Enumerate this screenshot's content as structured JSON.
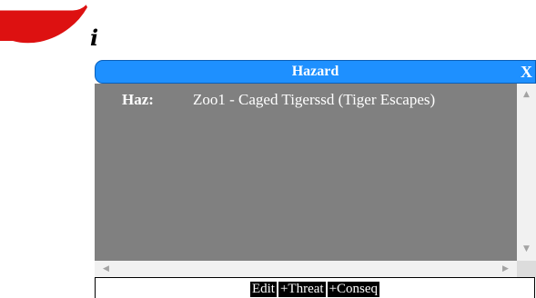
{
  "info_icon": "i",
  "hazard_panel": {
    "title": "Hazard",
    "close_label": "X",
    "haz_label": "Haz:",
    "haz_value": "Zoo1 - Caged Tigerssd (Tiger Escapes)"
  },
  "actions": {
    "edit": "Edit",
    "add_threat": "+Threat",
    "add_conseq": "+Conseq"
  },
  "colors": {
    "title_bar": "#1e90ff",
    "content_bg": "#808080",
    "swoosh": "#dd1111"
  }
}
